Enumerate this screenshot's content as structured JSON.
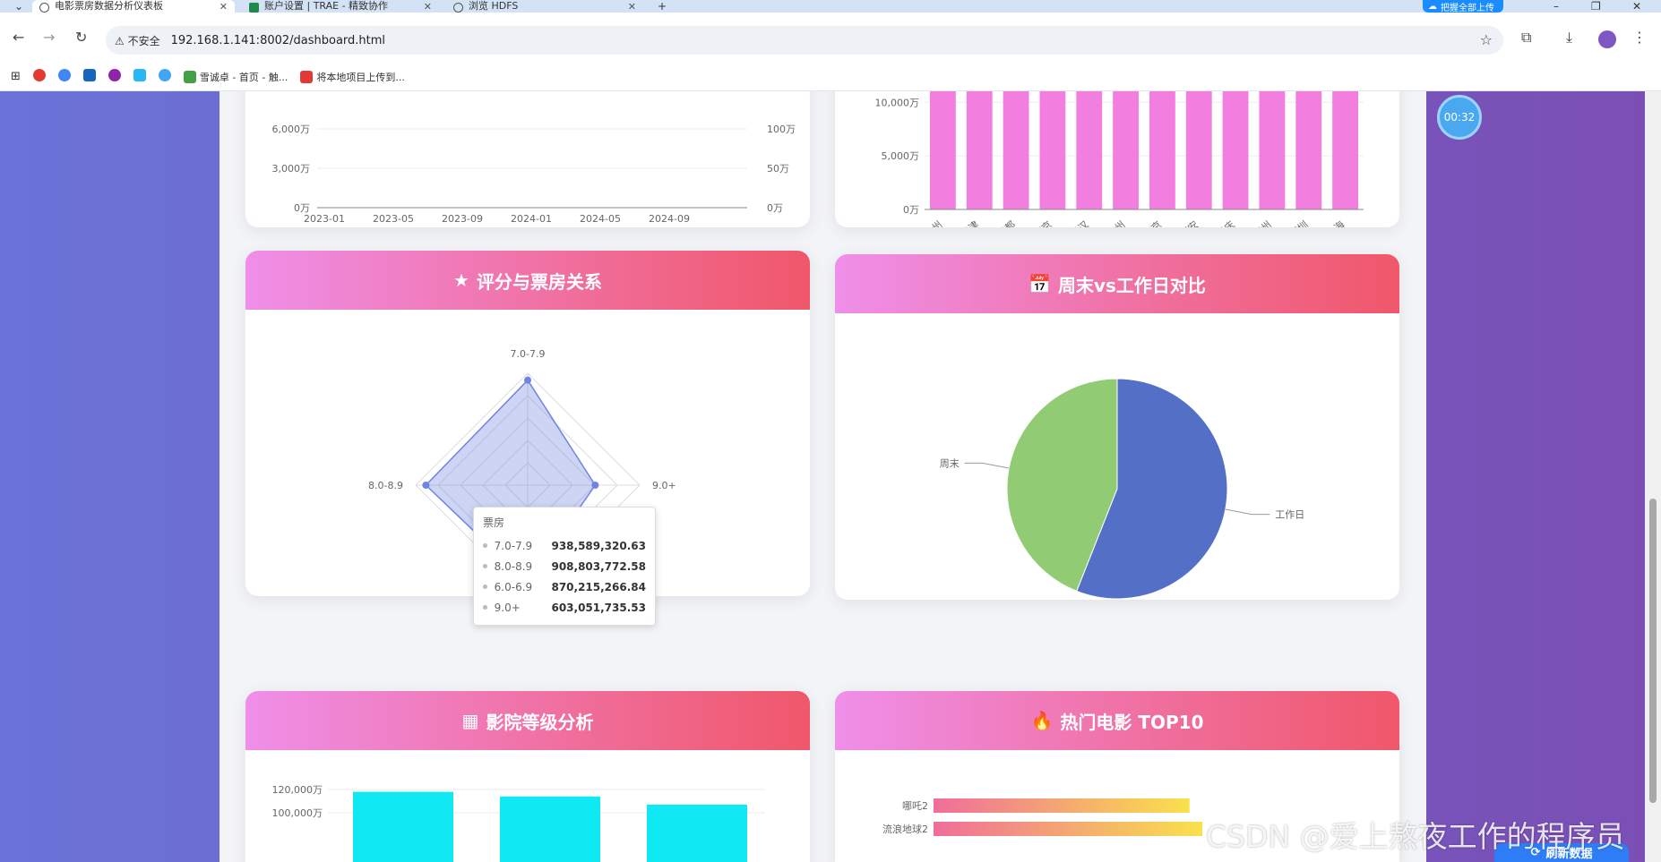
{
  "browser": {
    "tabs": [
      {
        "label": "电影票房数据分析仪表板",
        "active": true
      },
      {
        "label": "账户设置 | TRAE - 精致协作",
        "active": false
      },
      {
        "label": "浏览 HDFS",
        "active": false
      }
    ],
    "new_tab": "+",
    "badge_label": "把握全部上传",
    "window_controls": {
      "minimize": "–",
      "restore": "❐",
      "close": "✕"
    },
    "security_warning": "⚠ 不安全",
    "url": "192.168.1.141:8002/dashboard.html",
    "bookmarks": [
      {
        "label": "",
        "color": "#e53935"
      },
      {
        "label": "",
        "color": "#4285f4"
      },
      {
        "label": "",
        "color": "#1565c0"
      },
      {
        "label": "",
        "color": "#8e24aa"
      },
      {
        "label": "",
        "color": "#29b6f6"
      },
      {
        "label": "",
        "color": "#42a5f5"
      },
      {
        "label": "雪诚卓 - 首页 - 触...",
        "color": "#43a047"
      },
      {
        "label": "将本地项目上传到...",
        "color": "#e53935"
      }
    ]
  },
  "timer": "00:32",
  "refresh_label": "刷新数据",
  "watermark": "CSDN @爱上熬夜工作的程序员",
  "cards": {
    "radar": {
      "title": "评分与票房关系",
      "icon": "★"
    },
    "pie": {
      "title": "周末vs工作日对比",
      "icon": "📅"
    },
    "cinema": {
      "title": "影院等级分析",
      "icon": "▦"
    },
    "top10": {
      "title": "热门电影 TOP10",
      "icon": "🔥"
    }
  },
  "tooltip": {
    "title": "票房",
    "rows": [
      {
        "name": "7.0-7.9",
        "value": "938,589,320.63"
      },
      {
        "name": "8.0-8.9",
        "value": "908,803,772.58"
      },
      {
        "name": "6.0-6.9",
        "value": "870,215,266.84"
      },
      {
        "name": "9.0+",
        "value": "603,051,735.53"
      }
    ]
  },
  "chart_data": [
    {
      "type": "line",
      "title": "",
      "x": [
        "2023-01",
        "2023-05",
        "2023-09",
        "2024-01",
        "2024-05",
        "2024-09"
      ],
      "y_left_ticks": [
        "0万",
        "3,000万",
        "6,000万"
      ],
      "y_right_ticks": [
        "0万",
        "50万",
        "100万"
      ],
      "ylim": [
        0,
        6000
      ]
    },
    {
      "type": "bar",
      "title": "",
      "categories": [
        "杭州",
        "天津",
        "成都",
        "南京",
        "武汉",
        "广州",
        "北京",
        "西安",
        "重庆",
        "苏州",
        "深圳",
        "上海"
      ],
      "values": [
        14000,
        14000,
        14000,
        14000,
        14000,
        14000,
        14000,
        14000,
        14000,
        14000,
        14000,
        14000
      ],
      "y_ticks": [
        "0万",
        "5,000万",
        "10,000万"
      ],
      "ylim": [
        0,
        10000
      ],
      "color": "#f27fe0"
    },
    {
      "type": "radar",
      "title": "",
      "indicators": [
        "7.0-7.9",
        "9.0+",
        "6.0-6.9",
        "8.0-8.9"
      ],
      "series": [
        {
          "name": "票房",
          "values": [
            938589320.63,
            603051735.53,
            870215266.84,
            908803772.58
          ]
        }
      ],
      "max": 1000000000,
      "color": "#6f84e0"
    },
    {
      "type": "pie",
      "title": "",
      "slices": [
        {
          "label": "工作日",
          "value": 56,
          "color": "#5470c6"
        },
        {
          "label": "周末",
          "value": 44,
          "color": "#91cc75"
        }
      ]
    },
    {
      "type": "bar",
      "title": "",
      "y_ticks": [
        "100,000万",
        "120,000万"
      ],
      "ylim": [
        100000,
        120000
      ],
      "values": [
        118000,
        114000,
        107000
      ],
      "color": "#10e8f4"
    },
    {
      "type": "bar",
      "title": "",
      "orientation": "horizontal",
      "categories": [
        "哪吒2",
        "流浪地球2"
      ],
      "values": [
        100,
        105
      ]
    }
  ]
}
